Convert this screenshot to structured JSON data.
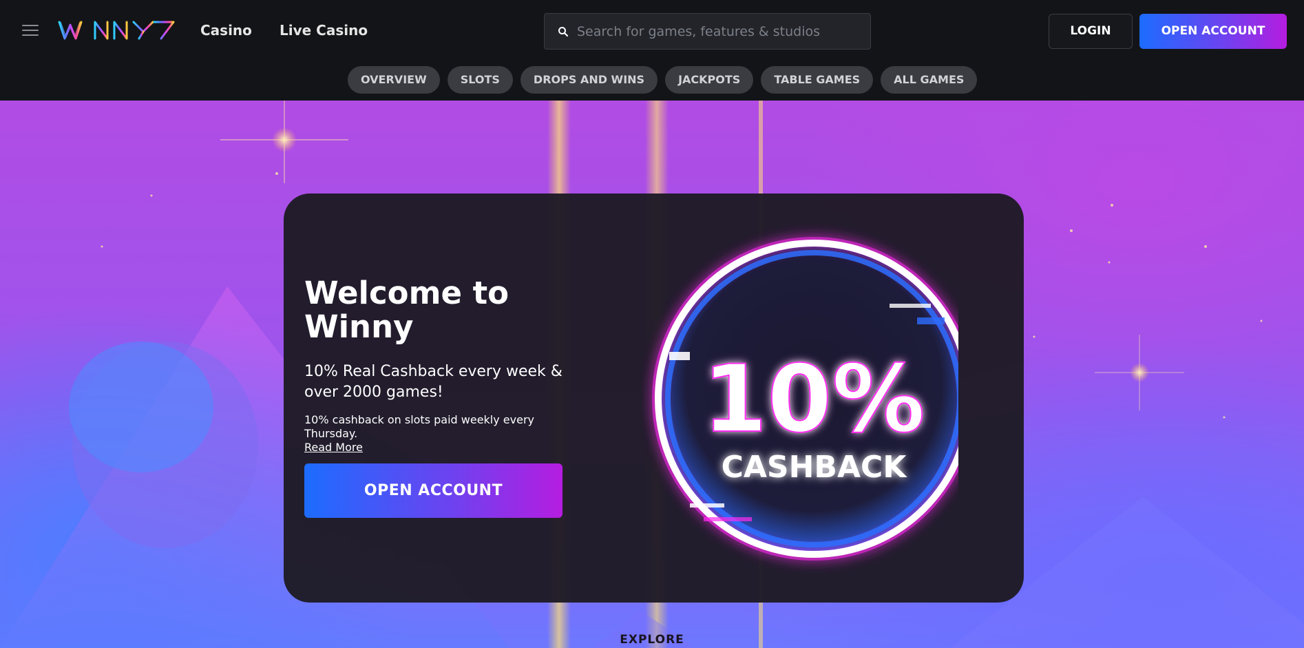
{
  "header": {
    "menu_icon": "hamburger-menu-icon",
    "logo_text": "WINNY",
    "nav": [
      "Casino",
      "Live Casino"
    ],
    "search": {
      "placeholder": "Search for games, features & studios",
      "value": "",
      "icon": "search-icon"
    },
    "login_label": "LOGIN",
    "open_account_label": "OPEN ACCOUNT"
  },
  "tabs": [
    "OVERVIEW",
    "SLOTS",
    "DROPS AND WINS",
    "JACKPOTS",
    "TABLE GAMES",
    "ALL GAMES"
  ],
  "hero": {
    "title": "Welcome to Winny",
    "subtitle": "10% Real Cashback every week & over 2000 games!",
    "description": "10% cashback on slots paid weekly every Thursday.",
    "read_more": "Read More",
    "cta": "OPEN ACCOUNT",
    "badge": {
      "percent": "10%",
      "label": "CASHBACK"
    }
  },
  "explore_label": "EXPLORE",
  "colors": {
    "header_bg": "#131417",
    "card_bg": "#1f1b26",
    "accent_blue": "#1c6cff",
    "accent_purple": "#b51de0",
    "hero_purple": "#b14ce4",
    "neon_pink": "#ff2bf0"
  }
}
